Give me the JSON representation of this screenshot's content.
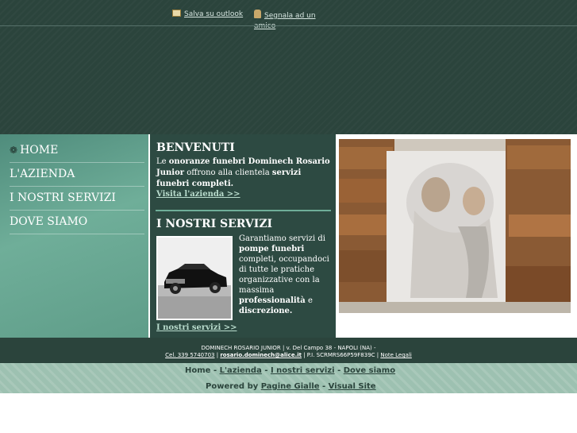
{
  "header": {
    "outlook_label": "Salva su outlook",
    "friend_label": "Segnala ad un amico"
  },
  "nav": {
    "items": [
      {
        "label": "HOME",
        "icon": "swirl-icon"
      },
      {
        "label": "L'AZIENDA"
      },
      {
        "label": "I NOSTRI SERVIZI"
      },
      {
        "label": "DOVE SIAMO"
      }
    ]
  },
  "welcome": {
    "title": "BENVENUTI",
    "text_1": "Le ",
    "text_bold_1": "onoranze funebri Dominech Rosario Junior",
    "text_2": " offrono alla clientela ",
    "text_bold_2": "servizi funebri completi.",
    "link": "Visita l'azienda >>"
  },
  "services": {
    "title": "I NOSTRI SERVIZI",
    "text_1": "Garantiamo servizi di ",
    "text_bold_1": "pompe funebri",
    "text_2": " completi, occupandoci di tutte le pratiche organizzative con la massima ",
    "text_bold_2": "professionalità",
    "text_3": " e ",
    "text_bold_3": "discrezione.",
    "link": "I nostri servizi >>"
  },
  "footer": {
    "line1": "DOMINECH ROSARIO JUNIOR | v. Del Campo 38 - NAPOLI (NA) -",
    "phone": "Cel. 339 5740703",
    "sep1": " | ",
    "email": "rosario.dominech@alice.it",
    "vat": " | P.I. SCRMRS66P59F839C | ",
    "legal": "Note Legali"
  },
  "footer_nav": {
    "home": "Home",
    "azienda": "L'azienda",
    "servizi": "I nostri servizi",
    "dove": "Dove siamo",
    "sep": " - ",
    "powered_by": "Powered by",
    "pagine_gialle": "Pagine Gialle",
    "visual_site": "Visual Site"
  },
  "colors": {
    "header_bg": "#2b443c",
    "nav_bg": "#6fae99",
    "content_bg": "#2d4a42",
    "footer_nav_bg": "#9dc1b1",
    "link_color": "#b9dccd"
  }
}
